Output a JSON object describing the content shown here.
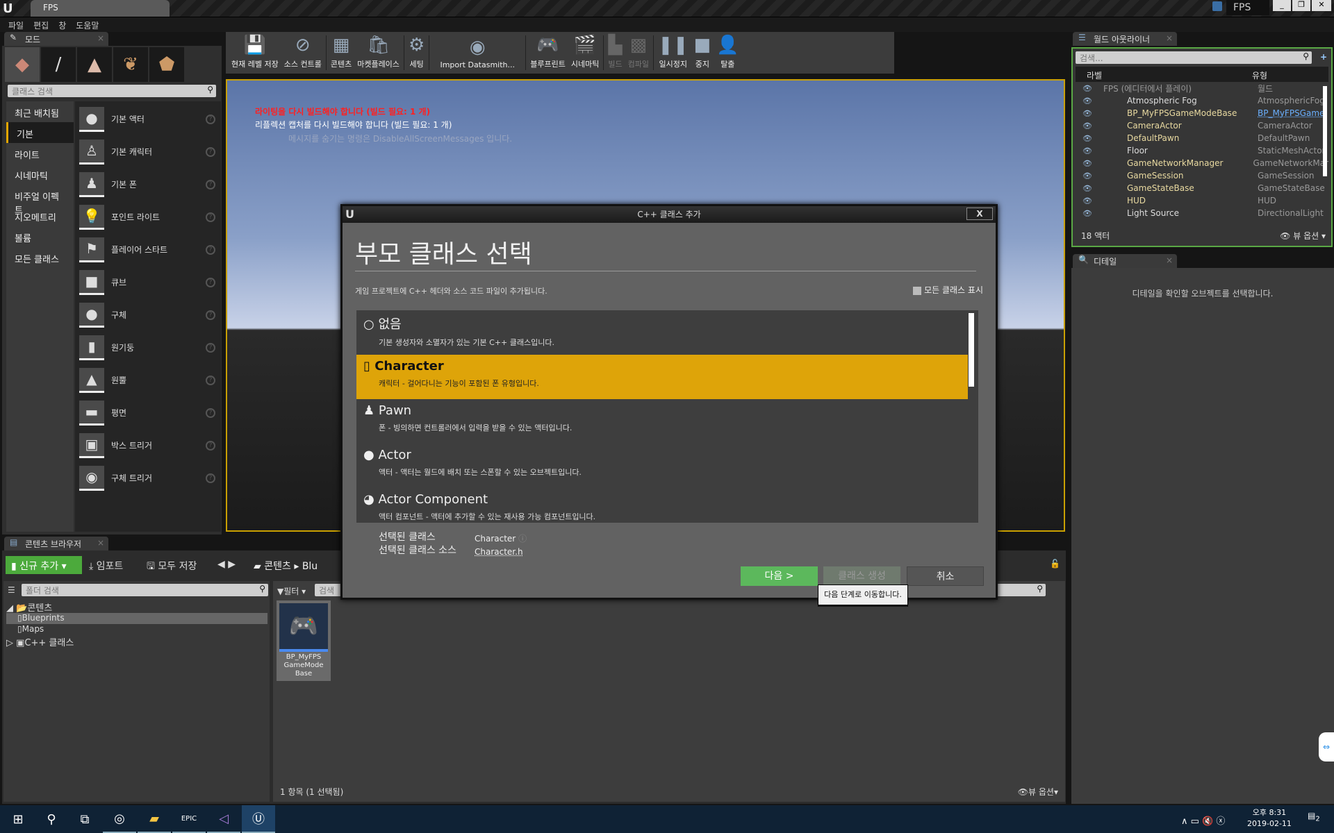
{
  "window": {
    "project_tab": "FPS",
    "project_badge": "FPS"
  },
  "menu": [
    "파일",
    "편집",
    "창",
    "도움말"
  ],
  "modes_panel": {
    "tab": "모드",
    "search_placeholder": "클래스 검색",
    "categories": [
      "최근 배치됨",
      "기본",
      "라이트",
      "시네마틱",
      "비주얼 이펙트",
      "지오메트리",
      "볼륨",
      "모든 클래스"
    ],
    "selected_category": "기본",
    "items": [
      "기본 액터",
      "기본 캐릭터",
      "기본 폰",
      "포인트 라이트",
      "플레이어 스타트",
      "큐브",
      "구체",
      "원기둥",
      "원뿔",
      "평면",
      "박스 트리거",
      "구체 트리거"
    ]
  },
  "toolbar": [
    {
      "label": "현재 레벨 저장",
      "icon": "save-icon"
    },
    {
      "label": "소스 컨트롤",
      "icon": "source-control-icon"
    },
    {
      "label": "콘텐츠",
      "icon": "content-icon"
    },
    {
      "label": "마켓플레이스",
      "icon": "marketplace-icon"
    },
    {
      "label": "세팅",
      "icon": "settings-icon"
    },
    {
      "label": "Import Datasmith...",
      "icon": "datasmith-icon"
    },
    {
      "label": "블루프린트",
      "icon": "blueprint-icon"
    },
    {
      "label": "시네마틱",
      "icon": "cinematic-icon"
    },
    {
      "label": "빌드",
      "icon": "build-icon",
      "disabled": true
    },
    {
      "label": "컴파일",
      "icon": "compile-icon",
      "disabled": true
    },
    {
      "label": "일시정지",
      "icon": "pause-icon"
    },
    {
      "label": "중지",
      "icon": "stop-icon"
    },
    {
      "label": "탈출",
      "icon": "eject-icon"
    }
  ],
  "viewport": {
    "messages": [
      "라이팅을 다시 빌드해야 합니다 (빌드 필요: 1 개)",
      "리플렉션 캡처를 다시 빌드해야 합니다 (빌드 필요: 1 개)",
      "메시지를 숨기는 명령은 DisableAllScreenMessages 입니다."
    ],
    "error_color": "#ff2020"
  },
  "outliner": {
    "tab": "월드 아웃라이너",
    "search_placeholder": "검색...",
    "col_label": "라벨",
    "col_type": "유형",
    "rows": [
      {
        "label": "FPS (에디터에서 플레이)",
        "type": "월드"
      },
      {
        "label": "Atmospheric Fog",
        "type": "AtmosphericFog"
      },
      {
        "label": "BP_MyFPSGameModeBase",
        "type": "BP_MyFPSGame"
      },
      {
        "label": "CameraActor",
        "type": "CameraActor"
      },
      {
        "label": "DefaultPawn",
        "type": "DefaultPawn"
      },
      {
        "label": "Floor",
        "type": "StaticMeshActor"
      },
      {
        "label": "GameNetworkManager",
        "type": "GameNetworkMar"
      },
      {
        "label": "GameSession",
        "type": "GameSession"
      },
      {
        "label": "GameStateBase",
        "type": "GameStateBase"
      },
      {
        "label": "HUD",
        "type": "HUD"
      },
      {
        "label": "Light Source",
        "type": "DirectionalLight"
      }
    ],
    "count": "18 액터",
    "view_options": "뷰 옵션"
  },
  "details": {
    "tab": "디테일",
    "empty": "디테일을 확인할 오브젝트를 선택합니다."
  },
  "content_browser": {
    "tab": "콘텐츠 브라우저",
    "add_new": "신규 추가",
    "import": "임포트",
    "save_all": "모두 저장",
    "path": [
      "콘텐츠",
      "Blu"
    ],
    "folder_search": "폴더 검색",
    "filter": "필터",
    "search": "검색",
    "tree": [
      {
        "label": "콘텐츠",
        "level": 0
      },
      {
        "label": "Blueprints",
        "level": 1,
        "selected": true
      },
      {
        "label": "Maps",
        "level": 1
      },
      {
        "label": "C++ 클래스",
        "level": 0
      }
    ],
    "asset": "BP_MyFPS GameMode Base",
    "status": "1 항목 (1 선택됨)",
    "view_options": "뷰 옵션"
  },
  "dialog": {
    "title": "C++ 클래스 추가",
    "heading": "부모 클래스 선택",
    "description": "게임 프로젝트에 C++ 헤더와 소스 코드 파일이 추가됩니다.",
    "show_all": "모든 클래스 표시",
    "classes": [
      {
        "name": "없음",
        "desc": "기본 생성자와 소멸자가 있는 기본 C++ 클래스입니다."
      },
      {
        "name": "Character",
        "desc": "캐릭터 - 걸어다니는 기능이 포함된 폰 유형입니다.",
        "selected": true
      },
      {
        "name": "Pawn",
        "desc": "폰 - 빙의하면 컨트롤러에서 입력을 받을 수 있는 액터입니다."
      },
      {
        "name": "Actor",
        "desc": "액터 - 액터는 월드에 배치 또는 스폰할 수 있는 오브젝트입니다."
      },
      {
        "name": "Actor Component",
        "desc": "액터 컴포넌트 - 액터에 추가할 수 있는 재사용 가능 컴포넌트입니다."
      }
    ],
    "selected_class_label": "선택된 클래스",
    "selected_class": "Character",
    "selected_source_label": "선택된 클래스 소스",
    "selected_source": "Character.h",
    "next": "다음 >",
    "create": "클래스 생성",
    "cancel": "취소",
    "tooltip": "다음 단계로 이동합니다.",
    "highlight": "#dea409",
    "next_color": "#5cb85c"
  },
  "taskbar": {
    "time": "오후 8:31",
    "date": "2019-02-11",
    "notifications": "2"
  }
}
